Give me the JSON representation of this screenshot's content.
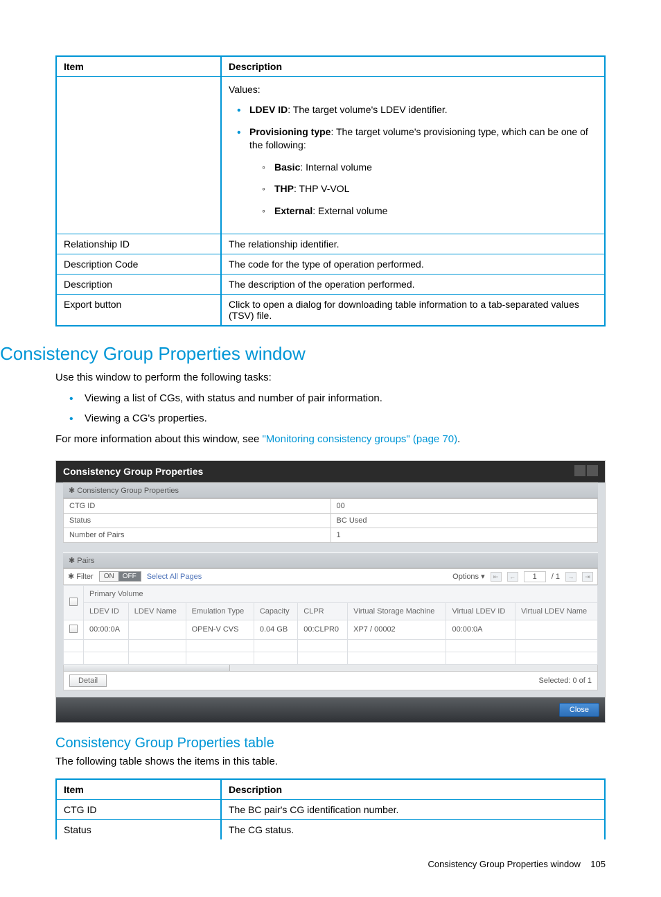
{
  "table1": {
    "headers": [
      "Item",
      "Description"
    ],
    "rows": [
      {
        "item": "",
        "desc": {
          "intro": "Values:",
          "bullets": [
            {
              "b": "LDEV ID",
              "t": ": The target volume's LDEV identifier."
            },
            {
              "b": "Provisioning type",
              "t": ": The target volume's provisioning type, which can be one of the following:",
              "sub": [
                {
                  "b": "Basic",
                  "t": ": Internal volume"
                },
                {
                  "b": "THP",
                  "t": ": THP V-VOL"
                },
                {
                  "b": "External",
                  "t": ": External volume"
                }
              ]
            }
          ]
        }
      },
      {
        "item": "Relationship ID",
        "desc": "The relationship identifier."
      },
      {
        "item": "Description Code",
        "desc": "The code for the type of operation performed."
      },
      {
        "item": "Description",
        "desc": "The description of the operation performed."
      },
      {
        "item": "Export button",
        "desc": "Click to open a dialog for downloading table information to a tab-separated values (TSV) file."
      }
    ]
  },
  "section": {
    "title": "Consistency Group Properties window",
    "intro": "Use this window to perform the following tasks:",
    "bullets": [
      "Viewing a list of CGs, with status and number of pair information.",
      "Viewing a CG's properties."
    ],
    "more": "For more information about this window, see ",
    "link": "\"Monitoring consistency groups\" (page 70)",
    "more_end": "."
  },
  "screenshot": {
    "title": "Consistency Group Properties",
    "panel": "✱ Consistency Group Properties",
    "summary": [
      [
        "CTG ID",
        "00"
      ],
      [
        "Status",
        "BC Used"
      ],
      [
        "Number of Pairs",
        "1"
      ]
    ],
    "pairs_head": "✱ Pairs",
    "filter_label": "✱ Filter",
    "on": "ON",
    "off": "OFF",
    "select_all": "Select All Pages",
    "options": "Options ▾",
    "page": "1",
    "page_total": "/ 1",
    "group_header": "Primary Volume",
    "cols": [
      "LDEV ID",
      "LDEV Name",
      "Emulation Type",
      "Capacity",
      "CLPR",
      "Virtual Storage Machine",
      "Virtual LDEV ID",
      "Virtual LDEV Name"
    ],
    "row": [
      "00:00:0A",
      "",
      "OPEN-V CVS",
      "0.04 GB",
      "00:CLPR0",
      "XP7 / 00002",
      "00:00:0A",
      ""
    ],
    "detail": "Detail",
    "selected": "Selected:  0   of   1",
    "close": "Close"
  },
  "subsection": {
    "title": "Consistency Group Properties table",
    "para": "The following table shows the items in this table."
  },
  "table2": {
    "headers": [
      "Item",
      "Description"
    ],
    "rows": [
      {
        "item": "CTG ID",
        "desc": "The BC pair's CG identification number."
      },
      {
        "item": "Status",
        "desc": "The CG status."
      }
    ]
  },
  "footer": {
    "left": "Consistency Group Properties window",
    "right": "105"
  }
}
